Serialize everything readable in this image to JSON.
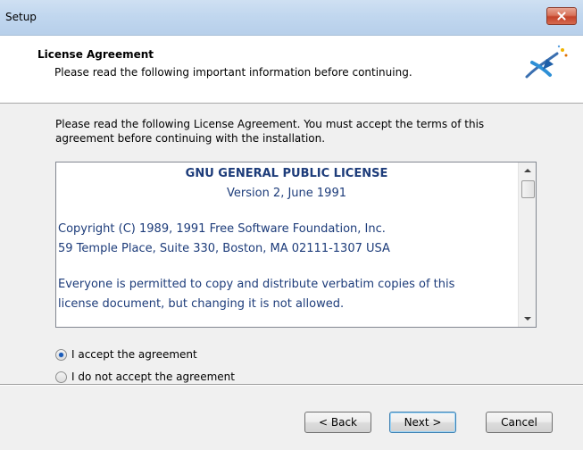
{
  "window": {
    "title": "Setup",
    "close_label": "Close"
  },
  "header": {
    "title": "License Agreement",
    "subtitle": "Please read the following important information before continuing."
  },
  "main": {
    "intro_text": "Please read the following License Agreement. You must accept the terms of this agreement before continuing with the installation.",
    "license": {
      "heading": "GNU GENERAL PUBLIC LICENSE",
      "version": "Version 2, June 1991",
      "copyright_line1": "Copyright (C) 1989, 1991 Free Software Foundation, Inc.",
      "copyright_line2": "59 Temple Place, Suite 330, Boston, MA  02111-1307  USA",
      "permission_line1": "Everyone is permitted to copy and distribute verbatim copies of this",
      "permission_line2": "license document, but changing it is not allowed."
    },
    "options": [
      {
        "label": "I accept the agreement",
        "selected": true
      },
      {
        "label": "I do not accept the agreement",
        "selected": false
      }
    ]
  },
  "buttons": {
    "back": "< Back",
    "next": "Next >",
    "cancel": "Cancel"
  },
  "colors": {
    "license_text": "#1d3c7a",
    "radio_selected": "#1a5bb8",
    "titlebar": "#c1d7ef"
  },
  "icons": {
    "close": "close-icon",
    "logo": "setup-wizard-logo",
    "scroll_up": "chevron-up-icon",
    "scroll_down": "chevron-down-icon"
  }
}
